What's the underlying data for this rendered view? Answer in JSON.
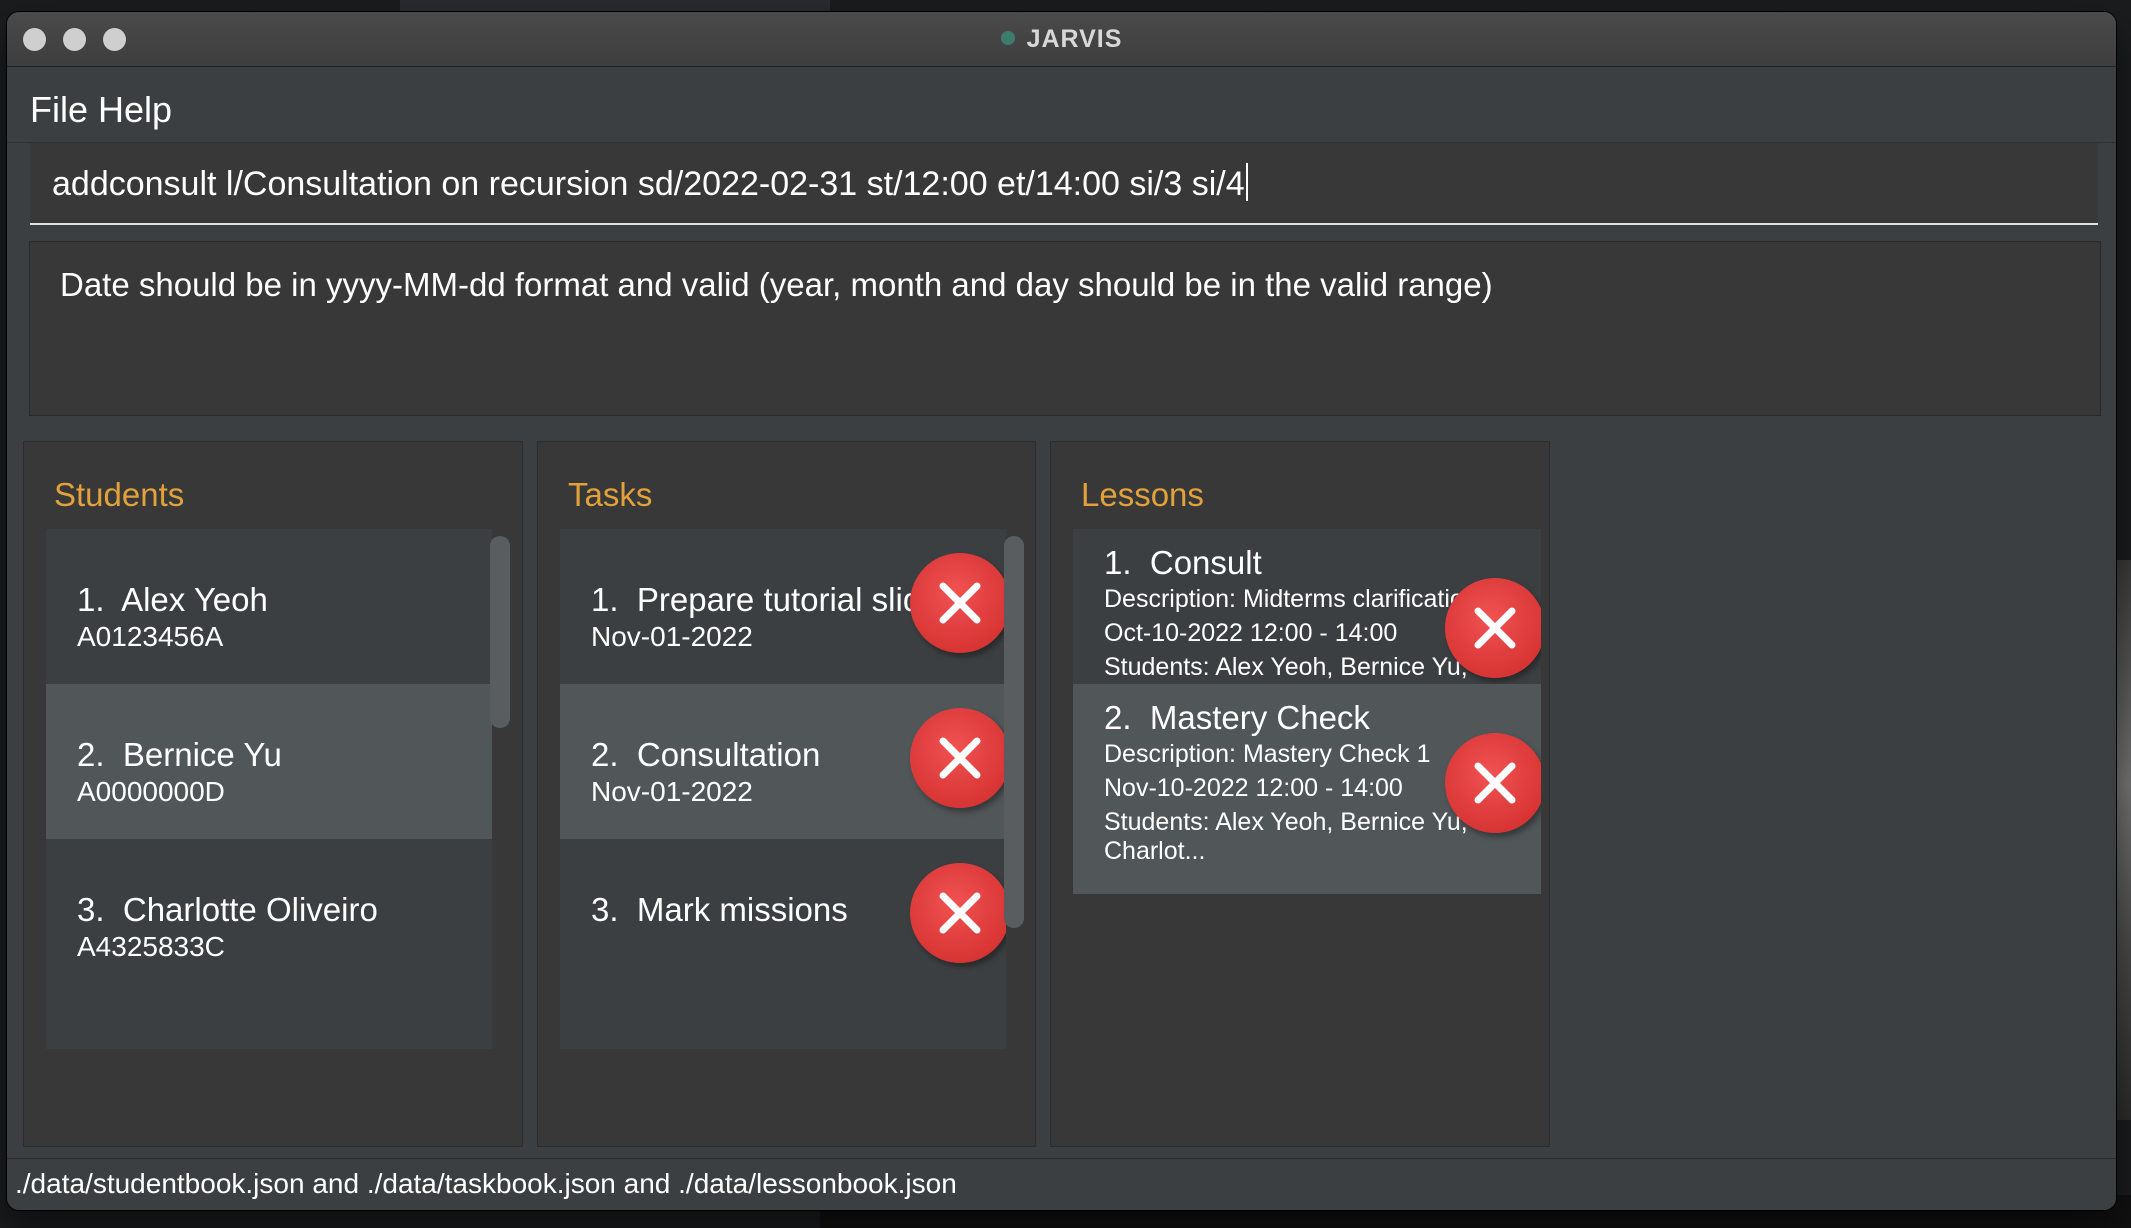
{
  "window": {
    "title": "JARVIS"
  },
  "menu": {
    "file": "File",
    "help": "Help"
  },
  "command_box": {
    "value": "addconsult l/Consultation on recursion sd/2022-02-31 st/12:00 et/14:00 si/3 si/4"
  },
  "result_display": {
    "text": "Date should be in yyyy-MM-dd format and valid (year, month and day should be in the valid range)"
  },
  "students": {
    "title": "Students",
    "items": [
      {
        "index": "1.",
        "name": "Alex Yeoh",
        "matric": "A0123456A"
      },
      {
        "index": "2.",
        "name": "Bernice Yu",
        "matric": "A0000000D"
      },
      {
        "index": "3.",
        "name": "Charlotte Oliveiro",
        "matric": "A4325833C"
      }
    ]
  },
  "tasks": {
    "title": "Tasks",
    "items": [
      {
        "index": "1.",
        "name": "Prepare tutorial slides",
        "date": "Nov-01-2022"
      },
      {
        "index": "2.",
        "name": "Consultation",
        "date": "Nov-01-2022"
      },
      {
        "index": "3.",
        "name": "Mark missions",
        "date": ""
      }
    ]
  },
  "lessons": {
    "title": "Lessons",
    "items": [
      {
        "index": "1.",
        "name": "Consult",
        "description": "Description: Midterms clarification",
        "time": "Oct-10-2022 12:00 - 14:00",
        "students": "Students: Alex Yeoh, Bernice Yu, Charlot..."
      },
      {
        "index": "2.",
        "name": "Mastery Check",
        "description": "Description: Mastery Check 1",
        "time": "Nov-10-2022 12:00 - 14:00",
        "students": "Students: Alex Yeoh, Bernice Yu, Charlot..."
      }
    ]
  },
  "status_bar": {
    "text": "./data/studentbook.json and ./data/taskbook.json and ./data/lessonbook.json"
  },
  "colors": {
    "accent": "#e2a13a",
    "delete": "#e04848",
    "selected_row": "#515658"
  },
  "icons": {
    "delete": "close-x-icon"
  }
}
